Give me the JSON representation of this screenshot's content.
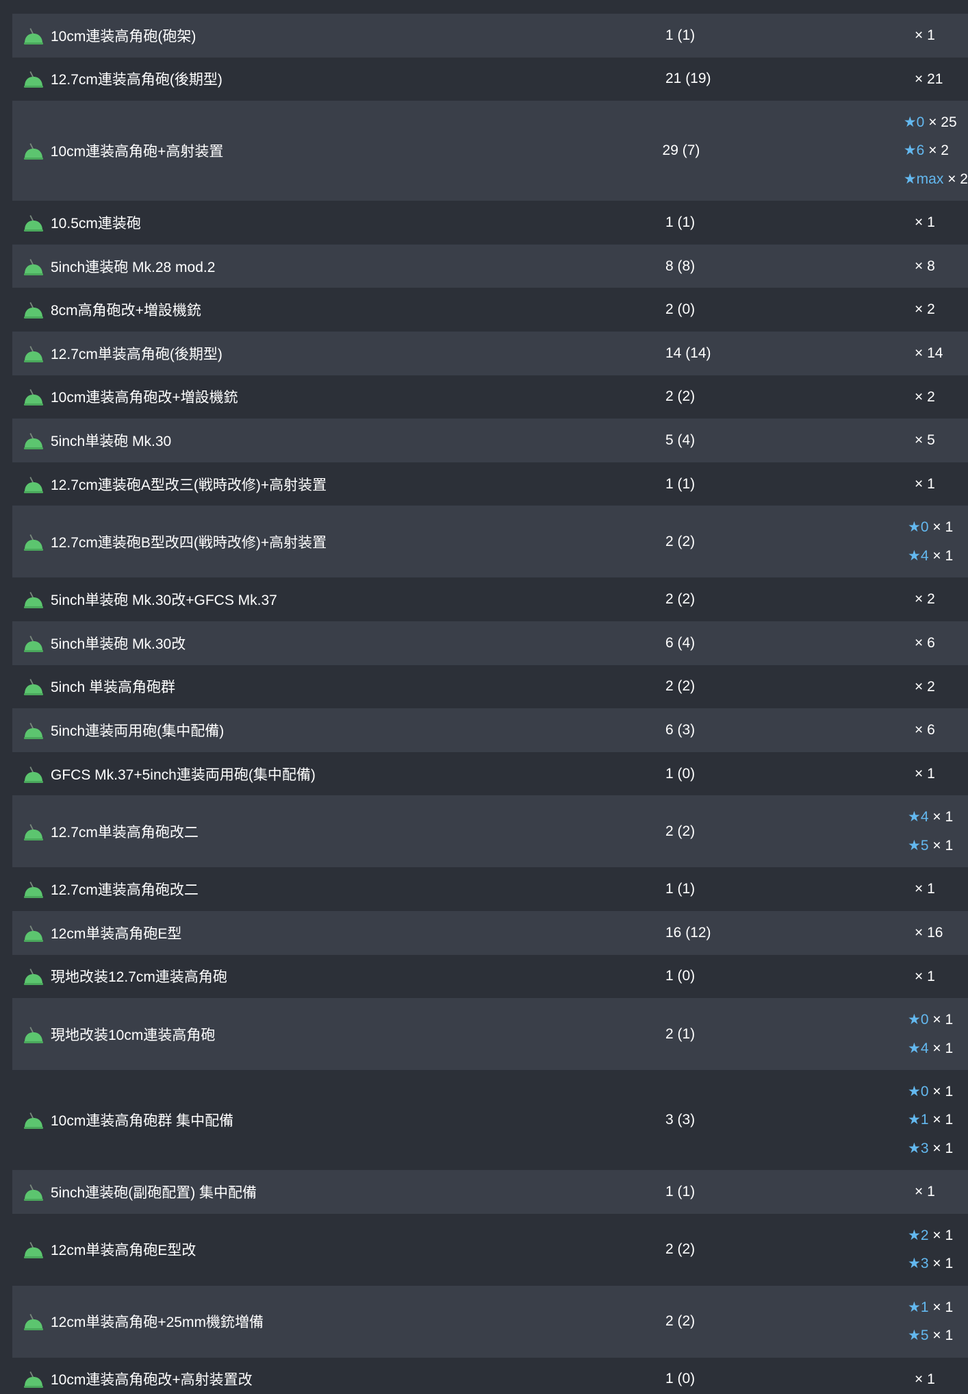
{
  "colors": {
    "background": "#2c3038",
    "row_alt": "#3a3f49",
    "text": "#ffffff",
    "star_accent": "#63b8ef",
    "icon_green": "#5cc56f"
  },
  "icon": "green-gun-mount-icon",
  "star_glyph": "★",
  "rows": [
    {
      "name": "10cm連装高角砲(砲架)",
      "count": "1 (1)",
      "mult": [
        {
          "level": "",
          "text": "× 1"
        }
      ]
    },
    {
      "name": "12.7cm連装高角砲(後期型)",
      "count": "21 (19)",
      "mult": [
        {
          "level": "",
          "text": "× 21"
        }
      ]
    },
    {
      "name": "10cm連装高角砲+高射装置",
      "count": "29 (7)",
      "mult": [
        {
          "level": "0",
          "text": "× 25"
        },
        {
          "level": "6",
          "text": "× 2"
        },
        {
          "level": "max",
          "text": "× 2"
        }
      ]
    },
    {
      "name": "10.5cm連装砲",
      "count": "1 (1)",
      "mult": [
        {
          "level": "",
          "text": "× 1"
        }
      ]
    },
    {
      "name": "5inch連装砲 Mk.28 mod.2",
      "count": "8 (8)",
      "mult": [
        {
          "level": "",
          "text": "× 8"
        }
      ]
    },
    {
      "name": "8cm高角砲改+増設機銃",
      "count": "2 (0)",
      "mult": [
        {
          "level": "",
          "text": "× 2"
        }
      ]
    },
    {
      "name": "12.7cm単装高角砲(後期型)",
      "count": "14 (14)",
      "mult": [
        {
          "level": "",
          "text": "× 14"
        }
      ]
    },
    {
      "name": "10cm連装高角砲改+増設機銃",
      "count": "2 (2)",
      "mult": [
        {
          "level": "",
          "text": "× 2"
        }
      ]
    },
    {
      "name": "5inch単装砲 Mk.30",
      "count": "5 (4)",
      "mult": [
        {
          "level": "",
          "text": "× 5"
        }
      ]
    },
    {
      "name": "12.7cm連装砲A型改三(戦時改修)+高射装置",
      "count": "1 (1)",
      "mult": [
        {
          "level": "",
          "text": "× 1"
        }
      ]
    },
    {
      "name": "12.7cm連装砲B型改四(戦時改修)+高射装置",
      "count": "2 (2)",
      "mult": [
        {
          "level": "0",
          "text": "× 1"
        },
        {
          "level": "4",
          "text": "× 1"
        }
      ]
    },
    {
      "name": "5inch単装砲 Mk.30改+GFCS Mk.37",
      "count": "2 (2)",
      "mult": [
        {
          "level": "",
          "text": "× 2"
        }
      ]
    },
    {
      "name": "5inch単装砲 Mk.30改",
      "count": "6 (4)",
      "mult": [
        {
          "level": "",
          "text": "× 6"
        }
      ]
    },
    {
      "name": "5inch 単装高角砲群",
      "count": "2 (2)",
      "mult": [
        {
          "level": "",
          "text": "× 2"
        }
      ]
    },
    {
      "name": "5inch連装両用砲(集中配備)",
      "count": "6 (3)",
      "mult": [
        {
          "level": "",
          "text": "× 6"
        }
      ]
    },
    {
      "name": "GFCS Mk.37+5inch連装両用砲(集中配備)",
      "count": "1 (0)",
      "mult": [
        {
          "level": "",
          "text": "× 1"
        }
      ]
    },
    {
      "name": "12.7cm単装高角砲改二",
      "count": "2 (2)",
      "mult": [
        {
          "level": "4",
          "text": "× 1"
        },
        {
          "level": "5",
          "text": "× 1"
        }
      ]
    },
    {
      "name": "12.7cm連装高角砲改二",
      "count": "1 (1)",
      "mult": [
        {
          "level": "",
          "text": "× 1"
        }
      ]
    },
    {
      "name": "12cm単装高角砲E型",
      "count": "16 (12)",
      "mult": [
        {
          "level": "",
          "text": "× 16"
        }
      ]
    },
    {
      "name": "現地改装12.7cm連装高角砲",
      "count": "1 (0)",
      "mult": [
        {
          "level": "",
          "text": "× 1"
        }
      ]
    },
    {
      "name": "現地改装10cm連装高角砲",
      "count": "2 (1)",
      "mult": [
        {
          "level": "0",
          "text": "× 1"
        },
        {
          "level": "4",
          "text": "× 1"
        }
      ]
    },
    {
      "name": "10cm連装高角砲群 集中配備",
      "count": "3 (3)",
      "mult": [
        {
          "level": "0",
          "text": "× 1"
        },
        {
          "level": "1",
          "text": "× 1"
        },
        {
          "level": "3",
          "text": "× 1"
        }
      ]
    },
    {
      "name": "5inch連装砲(副砲配置) 集中配備",
      "count": "1 (1)",
      "mult": [
        {
          "level": "",
          "text": "× 1"
        }
      ]
    },
    {
      "name": "12cm単装高角砲E型改",
      "count": "2 (2)",
      "mult": [
        {
          "level": "2",
          "text": "× 1"
        },
        {
          "level": "3",
          "text": "× 1"
        }
      ]
    },
    {
      "name": "12cm単装高角砲+25mm機銃増備",
      "count": "2 (2)",
      "mult": [
        {
          "level": "1",
          "text": "× 1"
        },
        {
          "level": "5",
          "text": "× 1"
        }
      ]
    },
    {
      "name": "10cm連装高角砲改+高射装置改",
      "count": "1 (0)",
      "mult": [
        {
          "level": "",
          "text": "× 1"
        }
      ]
    }
  ]
}
